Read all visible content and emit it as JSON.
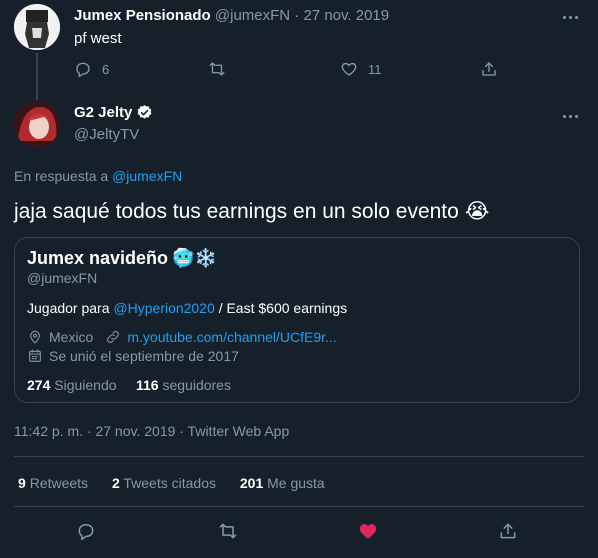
{
  "parent_tweet": {
    "name": "Jumex Pensionado",
    "handle": "@jumexFN",
    "separator": "·",
    "date": "27 nov. 2019",
    "text": "pf west",
    "replies": "6",
    "likes": "11"
  },
  "main_tweet": {
    "name": "G2 Jelty",
    "handle": "@JeltyTV",
    "reply_prefix": "En respuesta a",
    "reply_to": "@jumexFN",
    "text": "jaja saqué todos tus earnings en un solo evento",
    "emoji": "😭",
    "timestamp": "11:42 p. m. · 27 nov. 2019 · Twitter Web App",
    "retweets_count": "9",
    "retweets_label": "Retweets",
    "quotes_count": "2",
    "quotes_label": "Tweets citados",
    "likes_count": "201",
    "likes_label": "Me gusta"
  },
  "profile_card": {
    "name": "Jumex navideño",
    "name_emojis": "🥶❄️",
    "handle": "@jumexFN",
    "bio_prefix": "Jugador para",
    "bio_mention": "@Hyperion2020",
    "bio_suffix": "/ East $600 earnings",
    "location": "Mexico",
    "link": "m.youtube.com/channel/UCfE9r...",
    "joined": "Se unió el septiembre de 2017",
    "following_count": "274",
    "following_label": "Siguiendo",
    "followers_count": "116",
    "followers_label": "seguidores"
  },
  "colors": {
    "background": "#15202b",
    "muted": "#8899a6",
    "link": "#1da1f2",
    "like": "#e0245e",
    "border": "#38444d"
  },
  "icons": [
    "reply-icon",
    "retweet-icon",
    "heart-icon",
    "share-icon",
    "more-icon",
    "verified-badge-icon",
    "location-icon",
    "link-icon",
    "calendar-icon"
  ]
}
